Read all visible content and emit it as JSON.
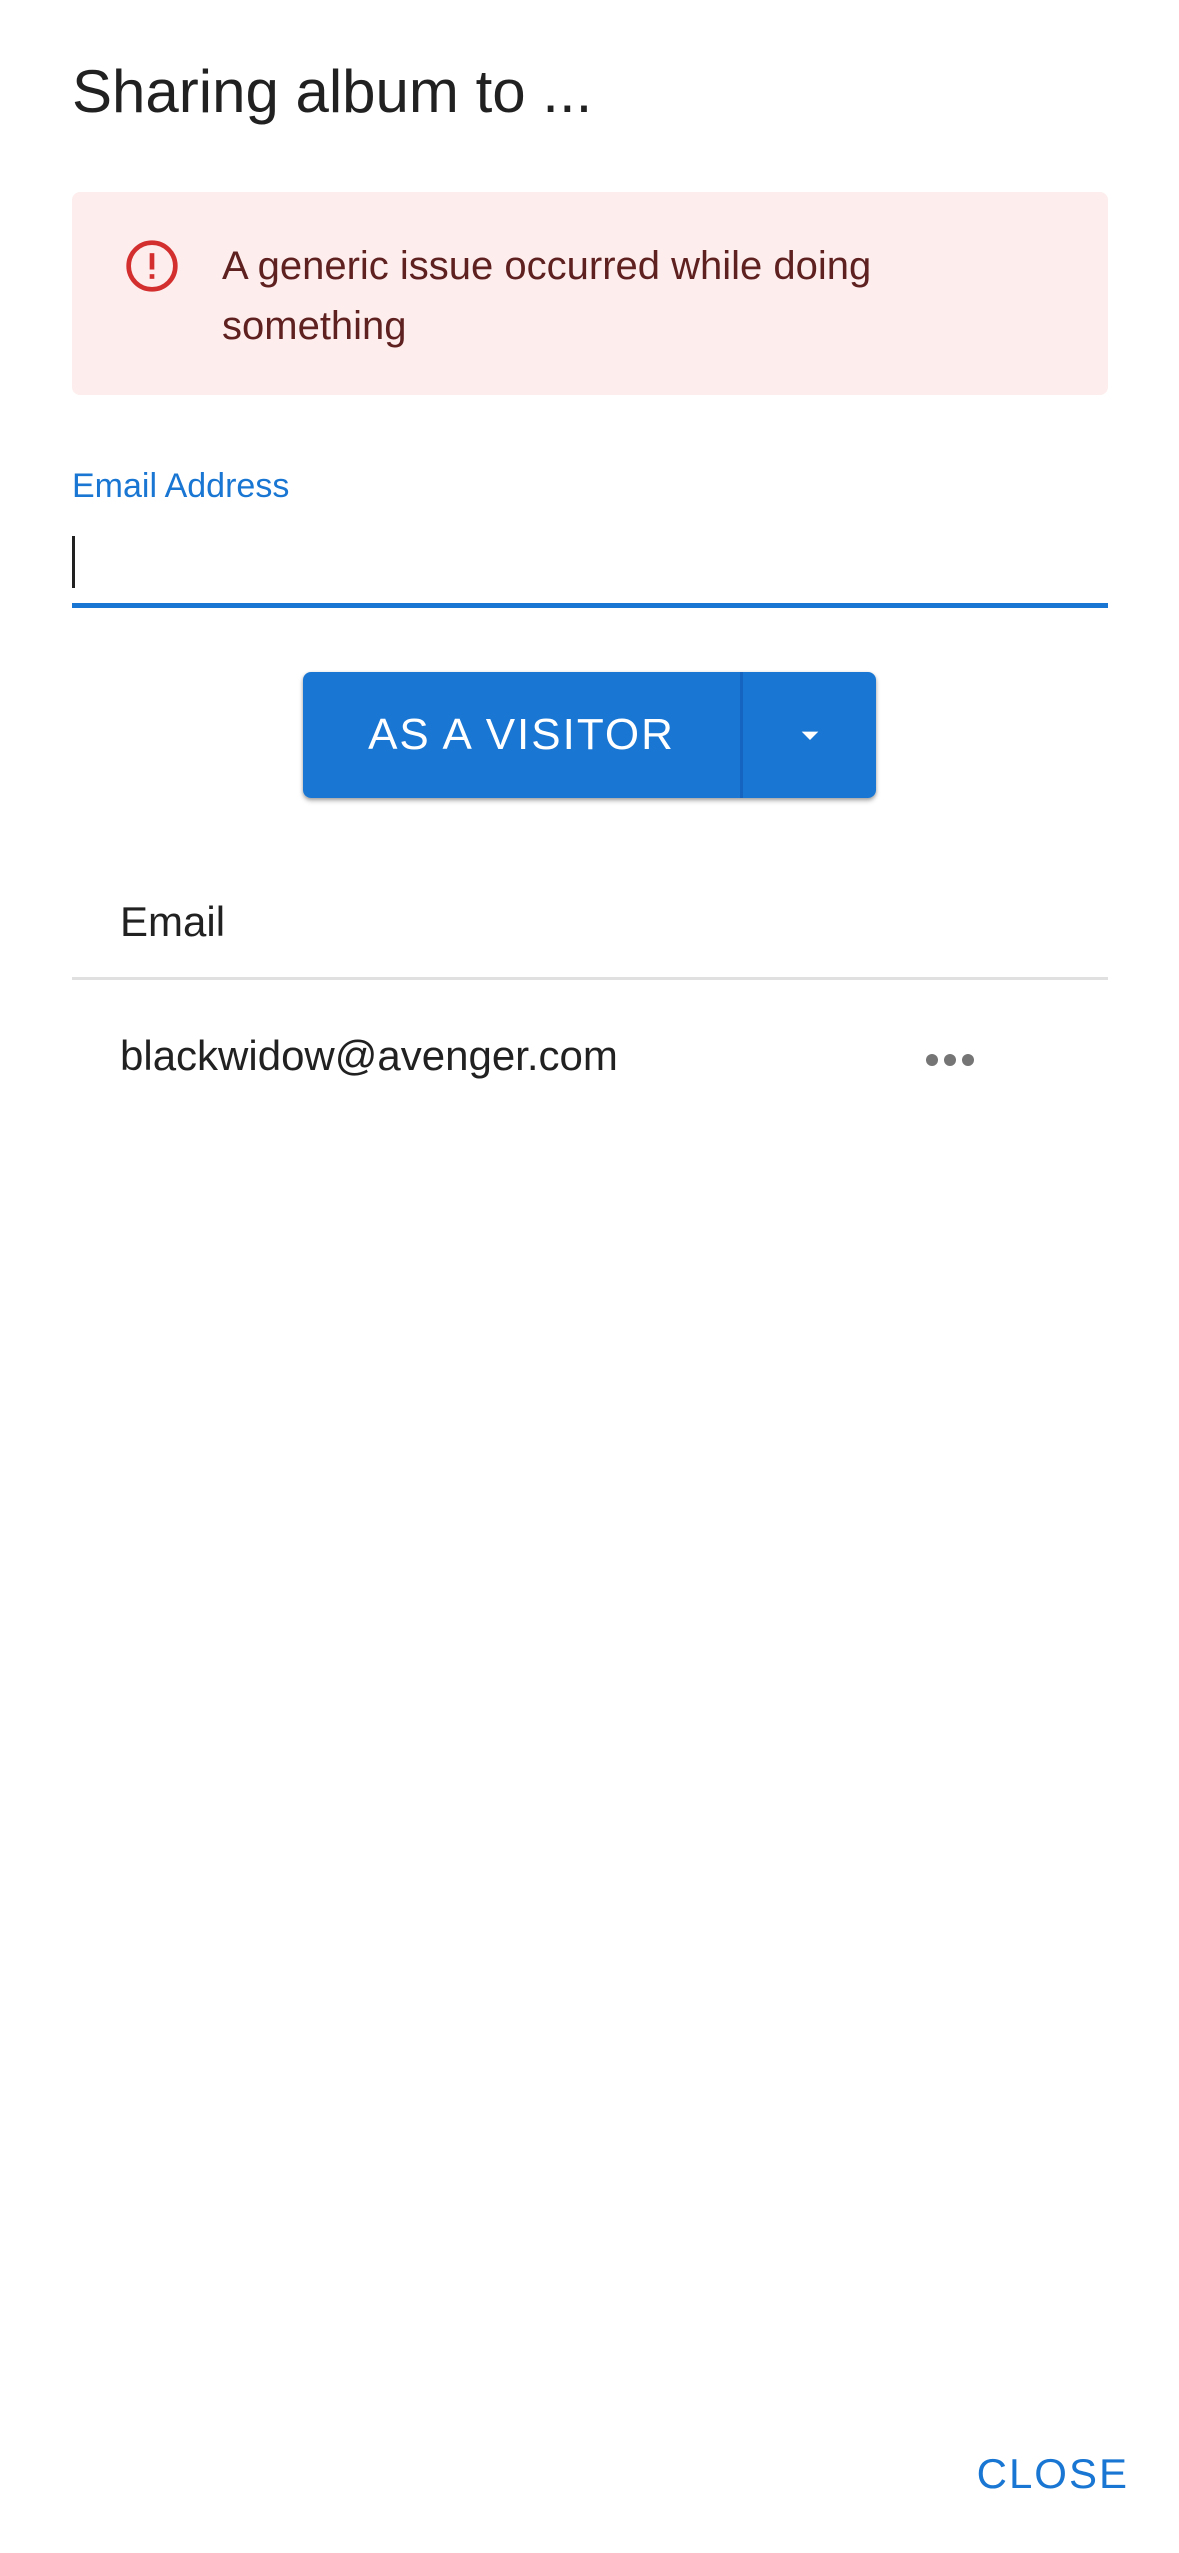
{
  "dialog": {
    "title": "Sharing album to ..."
  },
  "alert": {
    "icon": "error-outline-icon",
    "message": "A generic issue occurred while doing something",
    "color": "#5f2120",
    "background": "#fdeded",
    "icon_color": "#d32f2f"
  },
  "email_field": {
    "label": "Email Address",
    "value": "",
    "accent": "#1976d2"
  },
  "share_button": {
    "label": "AS A VISITOR",
    "dropdown_icon": "arrow-drop-down-icon",
    "color": "#1976d2"
  },
  "table": {
    "headers": [
      "Email"
    ],
    "rows": [
      {
        "email": "blackwidow@avenger.com",
        "menu_icon": "more-horiz-icon"
      }
    ]
  },
  "footer": {
    "close_label": "CLOSE"
  }
}
